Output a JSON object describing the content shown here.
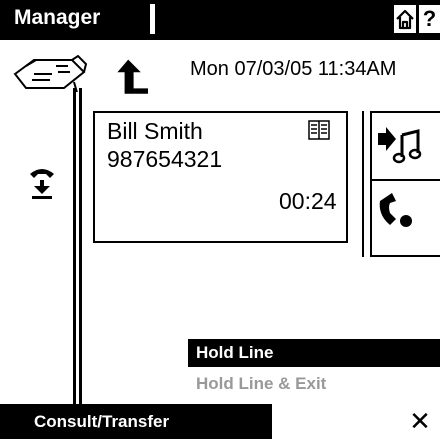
{
  "titlebar": {
    "title": "Manager",
    "help_label": "?"
  },
  "header": {
    "datetime": "Mon 07/03/05 11:34AM"
  },
  "call": {
    "name": "Bill Smith",
    "number": "987654321",
    "timer": "00:24"
  },
  "menu": {
    "items": [
      {
        "label": "Hold Line"
      },
      {
        "label": "Hold Line & Exit"
      }
    ]
  },
  "footer": {
    "consult_label": "Consult/Transfer",
    "close_label": "✕"
  }
}
